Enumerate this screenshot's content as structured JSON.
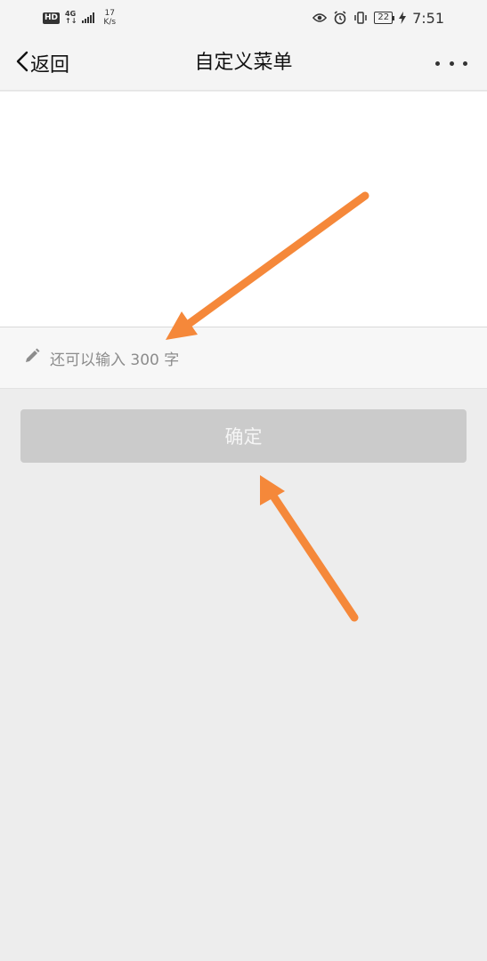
{
  "status_bar": {
    "hd": "HD",
    "network_type_top": "4G",
    "network_type_bottom": "↑↓",
    "speed_value": "17",
    "speed_unit": "K/s",
    "battery_level": "22",
    "time": "7:51",
    "icons": [
      "eye-icon",
      "alarm-icon",
      "vibrate-icon",
      "battery-icon",
      "charging-icon"
    ]
  },
  "nav": {
    "back_label": "返回",
    "title": "自定义菜单",
    "more_icon": "more-dots-icon"
  },
  "editor": {
    "value": "",
    "counter_text": "还可以输入 300 字",
    "counter_icon": "pencil-icon"
  },
  "actions": {
    "confirm_label": "确定"
  },
  "colors": {
    "accent_arrow": "#f5883a",
    "button_disabled": "#cbcbcb",
    "background": "#ededed"
  }
}
